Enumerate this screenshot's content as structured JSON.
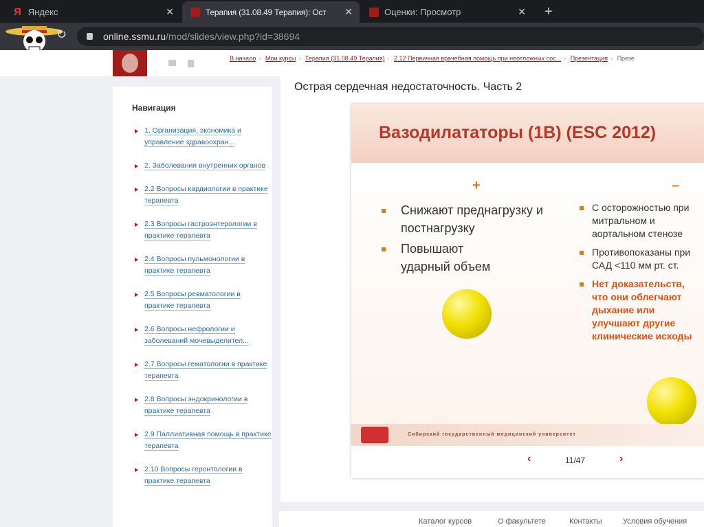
{
  "browser": {
    "tabs": [
      {
        "title": "Яндекс"
      },
      {
        "title": "Терапия (31.08.49 Терапия): Ост"
      },
      {
        "title": "Оценки: Просмотр"
      }
    ],
    "url_host": "online.ssmu.ru",
    "url_path": "/mod/slides/view.php?id=38694"
  },
  "breadcrumbs": [
    "В начало",
    "Мои курсы",
    "Терапия (31.08.49 Терапия)",
    "2.12 Первичная врачебная помощь при неотложных сос...",
    "Презентация",
    "Презе"
  ],
  "nav": {
    "title": "Навигация",
    "items": [
      "1. Организация, экономика и управление здравоохран...",
      "2. Заболевания внутренних органов",
      "2.2 Вопросы кардиологии в практике терапевта",
      "2.3 Вопросы гастроэнтерологии в практике терапевта",
      "2.4 Вопросы пульмонологии в практике терапевта",
      "2.5 Вопросы ревматологии в практике терапевта",
      "2.6 Вопросы нефрологии и заболеваний мочевыделител...",
      "2.7 Вопросы гематологии в практике терапевта",
      "2.8 Вопросы эндокринологии в практике терапевта",
      "2.9 Паллиативная помощь в практике терапевта",
      "2.10 Вопросы геронтологии в практике терапевта"
    ]
  },
  "page_title": "Острая сердечная недостаточность. Часть 2",
  "slide": {
    "title": "Вазодилататоры (1B) (ESC 2012)",
    "plus": "+",
    "minus": "–",
    "pros": [
      "Снижают преднагрузку и постнагрузку",
      "Повышают ударный объем"
    ],
    "cons": [
      "С осторожностью при митральном и аортальном стенозе",
      "Противопоказаны при САД <110 мм рт. ст.",
      "Нет доказательств, что они облегчают дыхание или улучшают другие клинические исходы"
    ],
    "footer": "Сибирский государственный медицинский университет"
  },
  "pager": {
    "label": "11/47",
    "prev": "‹",
    "next": "›"
  },
  "footer": [
    "Каталог курсов",
    "О факультете",
    "Контакты",
    "Условия обучения"
  ]
}
